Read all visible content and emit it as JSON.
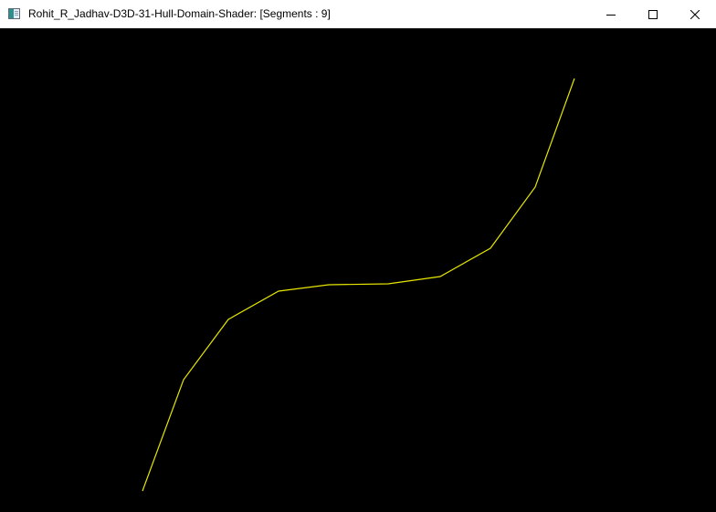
{
  "window": {
    "title": "Rohit_R_Jadhav-D3D-31-Hull-Domain-Shader: [Segments : 9]",
    "icon": "application-window-icon",
    "controls": {
      "minimize": "minimize-icon",
      "maximize": "maximize-icon",
      "close": "close-icon"
    }
  },
  "scene": {
    "background_color": "#000000",
    "curve_color": "#e6e600",
    "segments": 9
  }
}
